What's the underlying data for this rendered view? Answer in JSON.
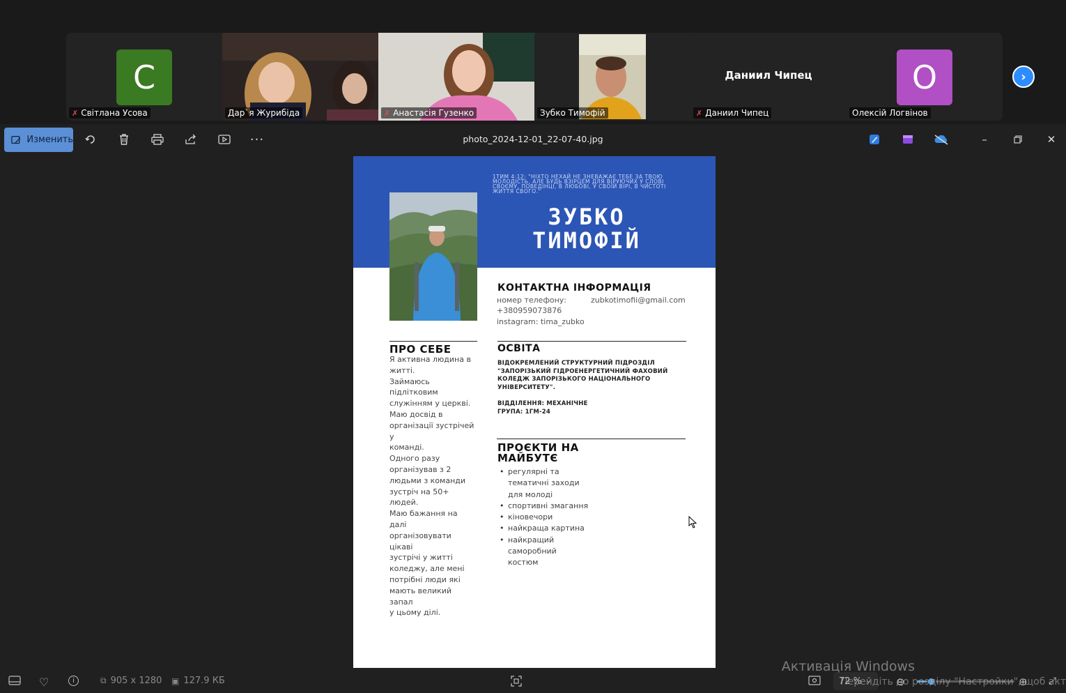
{
  "participants": [
    {
      "name": "Світлана Усова",
      "initial": "C",
      "avatar_color": "#3a7a22",
      "muted": true
    },
    {
      "name": "Дар`я Журибіда",
      "muted": false
    },
    {
      "name": "Анастасія Гузенко",
      "muted": true
    },
    {
      "name": "Зубко Тимофій",
      "muted": false,
      "active": true
    },
    {
      "name": "Даниил Чипец",
      "display_name": "Даниил Чипец",
      "muted": true
    },
    {
      "name": "Олексій Логвінов",
      "initial": "О",
      "avatar_color": "#b14fc5",
      "muted": false
    }
  ],
  "toolbar": {
    "edit_label": "Изменить",
    "filename": "photo_2024-12-01_22-07-40.jpg"
  },
  "status": {
    "dimensions": "905 x 1280",
    "file_size": "127.9 КБ",
    "zoom": "72 %"
  },
  "watermark": {
    "line1": "Активація Windows",
    "line2": "Перейдіть до розділу \"Настройки\", щоб акт"
  },
  "cv": {
    "quote": "1ТИМ 4:12: \"Ніхто нехай не зневажає тебе за твою молодість, але будь взірцем для віруючих у слові своєму, поведінці, в любові, у своїй вірі, в чистоті життя свого.\"",
    "first_line": "ЗУБКО",
    "second_line": "ТИМОФІЙ",
    "contact_title": "КОНТАКТНА ІНФОРМАЦІЯ",
    "phone_label": "номер телефону:",
    "phone": "+380959073876",
    "email": "zubkotimofii@gmail.com",
    "instagram": "instagram: tima_zubko",
    "about_title": "ПРО СЕБЕ",
    "about": [
      "Я активна людина в",
      "житті.",
      "Займаюсь",
      "підлітковим",
      "служінням у церкві.",
      "Маю досвід в",
      "організації зустрічей у",
      "команді.",
      "Одного разу",
      "організував з 2",
      "людьми з команди",
      "зустріч на 50+ людей.",
      "Маю бажання на далі",
      "організовувати цікаві",
      "зустрічі у житті",
      "коледжу, але мені",
      "потрібні люди які",
      "мають великий запал",
      "у цьому ділі."
    ],
    "education_title": "ОСВІТА",
    "education_lines": [
      "ВІДОКРЕМЛЕНИЙ СТРУКТУРНИЙ ПІДРОЗДІЛ",
      "\"ЗАПОРІЗЬКИЙ ГІДРОЕНЕРГЕТИЧНИЙ ФАХОВИЙ",
      "КОЛЕДЖ ЗАПОРІЗЬКОГО НАЦІОНАЛЬНОГО",
      "УНІВЕРСИТЕТУ\"."
    ],
    "department": "ВІДДІЛЕННЯ: МЕХАНІЧНЕ",
    "group": "ГРУПА: 1ГМ-24",
    "projects_title_1": "ПРОЄКТИ НА",
    "projects_title_2": "МАЙБУТЄ",
    "projects": [
      [
        "регулярні та",
        "тематичні заходи",
        "для молоді"
      ],
      [
        "спортивні змагання"
      ],
      [
        "кіновечори"
      ],
      [
        "найкраща картина"
      ],
      [
        "найкращий",
        "саморобний",
        "костюм"
      ]
    ]
  }
}
